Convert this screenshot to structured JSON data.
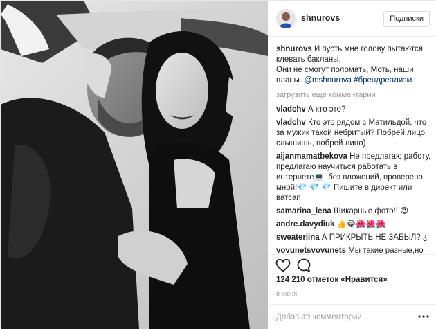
{
  "post": {
    "author": "shnurovs",
    "follow_label": "Подписки",
    "caption": {
      "user": "shnurovs",
      "text": "И пусть мне голову пытаются клевать бакланы,\nОни не смогут поломать, Моть, наши планы.",
      "mention": "@mshnurova",
      "hashtag": "#брендреализм"
    },
    "load_more": "загрузить еще комментарии",
    "comments": [
      {
        "user": "vladchv",
        "text": "А кто это?"
      },
      {
        "user": "vladchv",
        "text": "Кто это рядом с Матильдой, что за мужик такой небритый? Побрей лицо, слышишь, побрей лицо)"
      },
      {
        "user": "aijanmamatbekova",
        "text": "Не предлагаю работу, предлагаю научиться работать в интернете💻, без вложений, проверено мной!💎 💎 💎 Пишите в директ или ватсап"
      },
      {
        "user": "samarina_lena",
        "text": "Шикарные фото!!!😍"
      },
      {
        "user": "andre.davydiuk",
        "text": "👍😂🌺🌺🌺"
      },
      {
        "user": "sweateriina",
        "text": "А ПРИКРЫТЬ НЕ ЗАБЫЛ? ¿"
      },
      {
        "user": "vovunetsvovunets",
        "text": "Мы такие разные,но всё таки мы ВМЕСТЕ!😂🎊"
      }
    ],
    "likes_text": "124 210 отметок «Нравится»",
    "date": "8 июня",
    "add_comment_placeholder": "Добавьте комментарий...",
    "icons": {
      "like": "heart-icon",
      "comment": "comment-bubble-icon",
      "more": "more-options-icon"
    }
  }
}
